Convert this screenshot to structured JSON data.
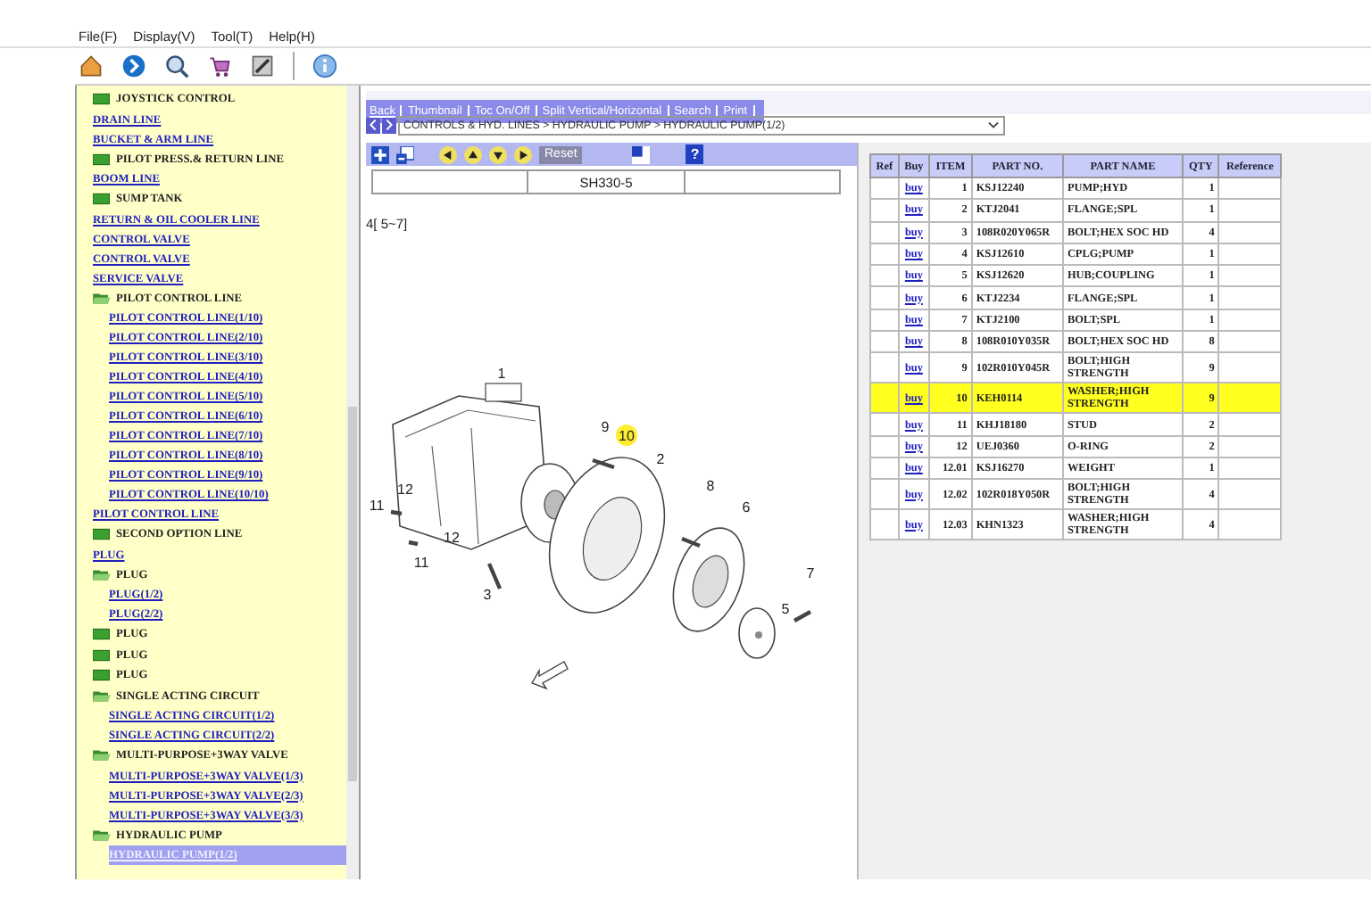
{
  "menu": [
    "File(F)",
    "Display(V)",
    "Tool(T)",
    "Help(H)"
  ],
  "nav": [
    {
      "kind": "folder",
      "label": "JOYSTICK CONTROL",
      "expanded": false
    },
    {
      "kind": "link",
      "label": "DRAIN LINE",
      "selected": false
    },
    {
      "kind": "link",
      "label": "BUCKET & ARM LINE",
      "selected": false
    },
    {
      "kind": "folder",
      "label": "PILOT PRESS.& RETURN LINE",
      "expanded": false
    },
    {
      "kind": "link",
      "label": "BOOM LINE",
      "selected": false
    },
    {
      "kind": "folder",
      "label": "SUMP TANK",
      "expanded": false
    },
    {
      "kind": "link",
      "label": "RETURN & OIL COOLER LINE",
      "selected": false
    },
    {
      "kind": "link",
      "label": "CONTROL VALVE",
      "selected": false
    },
    {
      "kind": "link",
      "label": "CONTROL VALVE",
      "selected": false
    },
    {
      "kind": "link",
      "label": "SERVICE VALVE",
      "selected": false
    },
    {
      "kind": "folder",
      "label": "PILOT CONTROL LINE",
      "expanded": true,
      "children": [
        {
          "label": "PILOT CONTROL LINE(1/10)",
          "selected": false
        },
        {
          "label": "PILOT CONTROL LINE(2/10)",
          "selected": false
        },
        {
          "label": "PILOT CONTROL LINE(3/10)",
          "selected": false
        },
        {
          "label": "PILOT CONTROL LINE(4/10)",
          "selected": false
        },
        {
          "label": "PILOT CONTROL LINE(5/10)",
          "selected": false
        },
        {
          "label": "PILOT CONTROL LINE(6/10)",
          "selected": false
        },
        {
          "label": "PILOT CONTROL LINE(7/10)",
          "selected": false
        },
        {
          "label": "PILOT CONTROL LINE(8/10)",
          "selected": false
        },
        {
          "label": "PILOT CONTROL LINE(9/10)",
          "selected": false
        },
        {
          "label": "PILOT CONTROL LINE(10/10)",
          "selected": false
        }
      ]
    },
    {
      "kind": "link",
      "label": "PILOT CONTROL LINE",
      "selected": false
    },
    {
      "kind": "folder",
      "label": "SECOND OPTION LINE",
      "expanded": false
    },
    {
      "kind": "link",
      "label": "PLUG",
      "selected": false
    },
    {
      "kind": "folder",
      "label": "PLUG",
      "expanded": true,
      "children": [
        {
          "label": "PLUG(1/2)",
          "selected": false
        },
        {
          "label": "PLUG(2/2)",
          "selected": false
        }
      ]
    },
    {
      "kind": "folder",
      "label": "PLUG",
      "expanded": false
    },
    {
      "kind": "folder",
      "label": "PLUG",
      "expanded": false
    },
    {
      "kind": "folder",
      "label": "PLUG",
      "expanded": false
    },
    {
      "kind": "folder",
      "label": "SINGLE ACTING CIRCUIT",
      "expanded": true,
      "children": [
        {
          "label": "SINGLE ACTING CIRCUIT(1/2)",
          "selected": false
        },
        {
          "label": "SINGLE ACTING CIRCUIT(2/2)",
          "selected": false
        }
      ]
    },
    {
      "kind": "folder",
      "label": "MULTI-PURPOSE+3WAY VALVE",
      "expanded": true,
      "children": [
        {
          "label": "MULTI-PURPOSE+3WAY VALVE(1/3)",
          "selected": false
        },
        {
          "label": "MULTI-PURPOSE+3WAY VALVE(2/3)",
          "selected": false
        },
        {
          "label": "MULTI-PURPOSE+3WAY VALVE(3/3)",
          "selected": false
        }
      ]
    },
    {
      "kind": "folder",
      "label": "HYDRAULIC PUMP",
      "expanded": true,
      "children": [
        {
          "label": "HYDRAULIC PUMP(1/2)",
          "selected": true
        }
      ]
    }
  ],
  "links": [
    "Back",
    "Thumbnail",
    "Toc On/Off",
    "Split Vertical/Horizontal",
    "Search",
    "Print"
  ],
  "breadcrumb": "CONTROLS & HYD. LINES > HYDRAULIC PUMP > HYDRAULIC PUMP(1/2)",
  "drawing_toolbar": {
    "reset": "Reset",
    "help": "?"
  },
  "model": "SH330-5",
  "page_ref": "4[ 5~7]",
  "callouts": [
    {
      "label": "1",
      "highlighted": false
    },
    {
      "label": "2",
      "highlighted": false
    },
    {
      "label": "3",
      "highlighted": false
    },
    {
      "label": "5",
      "highlighted": false
    },
    {
      "label": "6",
      "highlighted": false
    },
    {
      "label": "7",
      "highlighted": false
    },
    {
      "label": "8",
      "highlighted": false
    },
    {
      "label": "9",
      "highlighted": false
    },
    {
      "label": "10",
      "highlighted": true
    },
    {
      "label": "11",
      "highlighted": false
    },
    {
      "label": "11",
      "highlighted": false
    },
    {
      "label": "12",
      "highlighted": false
    },
    {
      "label": "12",
      "highlighted": false
    }
  ],
  "parts_table": {
    "columns": [
      "Ref",
      "Buy",
      "ITEM",
      "PART NO.",
      "PART NAME",
      "QTY",
      "Reference"
    ],
    "rows": [
      {
        "buy": "buy",
        "item": "1",
        "part_no": "KSJ12240",
        "part_name": "PUMP;HYD",
        "qty": "1",
        "selected": false
      },
      {
        "buy": "buy",
        "item": "2",
        "part_no": "KTJ2041",
        "part_name": "FLANGE;SPL",
        "qty": "1",
        "selected": false
      },
      {
        "buy": "buy",
        "item": "3",
        "part_no": "108R020Y065R",
        "part_name": "BOLT;HEX SOC HD",
        "qty": "4",
        "selected": false
      },
      {
        "buy": "buy",
        "item": "4",
        "part_no": "KSJ12610",
        "part_name": "CPLG;PUMP",
        "qty": "1",
        "selected": false
      },
      {
        "buy": "buy",
        "item": "5",
        "part_no": "KSJ12620",
        "part_name": "HUB;COUPLING",
        "qty": "1",
        "selected": false
      },
      {
        "buy": "buy",
        "item": "6",
        "part_no": "KTJ2234",
        "part_name": "FLANGE;SPL",
        "qty": "1",
        "selected": false
      },
      {
        "buy": "buy",
        "item": "7",
        "part_no": "KTJ2100",
        "part_name": "BOLT;SPL",
        "qty": "1",
        "selected": false
      },
      {
        "buy": "buy",
        "item": "8",
        "part_no": "108R010Y035R",
        "part_name": "BOLT;HEX SOC HD",
        "qty": "8",
        "selected": false
      },
      {
        "buy": "buy",
        "item": "9",
        "part_no": "102R010Y045R",
        "part_name": "BOLT;HIGH STRENGTH",
        "qty": "9",
        "selected": false
      },
      {
        "buy": "buy",
        "item": "10",
        "part_no": "KEH0114",
        "part_name": "WASHER;HIGH STRENGTH",
        "qty": "9",
        "selected": true
      },
      {
        "buy": "buy",
        "item": "11",
        "part_no": "KHJ18180",
        "part_name": "STUD",
        "qty": "2",
        "selected": false
      },
      {
        "buy": "buy",
        "item": "12",
        "part_no": "UEJ0360",
        "part_name": "O-RING",
        "qty": "2",
        "selected": false
      },
      {
        "buy": "buy",
        "item": "12.01",
        "part_no": "KSJ16270",
        "part_name": "WEIGHT",
        "qty": "1",
        "selected": false
      },
      {
        "buy": "buy",
        "item": "12.02",
        "part_no": "102R018Y050R",
        "part_name": "BOLT;HIGH STRENGTH",
        "qty": "4",
        "selected": false
      },
      {
        "buy": "buy",
        "item": "12.03",
        "part_no": "KHN1323",
        "part_name": "WASHER;HIGH STRENGTH",
        "qty": "4",
        "selected": false
      }
    ]
  }
}
